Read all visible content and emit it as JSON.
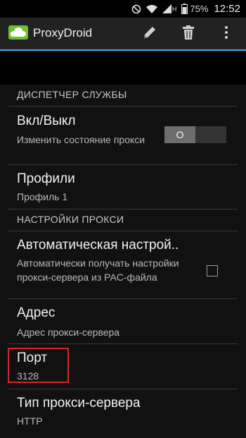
{
  "status_bar": {
    "battery_percent": "75%",
    "time": "12:52",
    "network_letter": "H",
    "icons": [
      "do-not-disturb-icon",
      "wifi-icon",
      "cellular-signal-icon",
      "battery-icon"
    ]
  },
  "action_bar": {
    "title": "ProxyDroid",
    "actions": [
      "edit-icon",
      "delete-icon",
      "overflow-menu-icon"
    ]
  },
  "service_section": {
    "header": "ДИСПЕТЧЕР СЛУЖБЫ",
    "toggle_pref": {
      "title": "Вкл/Выкл",
      "summary": "Изменить состояние прокси",
      "toggle_label": "O"
    },
    "profile_pref": {
      "title": "Профили",
      "summary": "Профиль 1"
    }
  },
  "proxy_section": {
    "header": "НАСТРОЙКИ ПРОКСИ",
    "auto_pref": {
      "title": "Автоматическая настрой..",
      "summary": "Автоматически получать настройки прокси-сервера из PAC-файла",
      "checked": false
    },
    "address_pref": {
      "title": "Адрес",
      "summary": "Адрес прокси-сервера"
    },
    "port_pref": {
      "title": "Порт",
      "summary": "3128"
    },
    "type_pref": {
      "title": "Тип прокси-сервера",
      "summary": "HTTP"
    }
  },
  "colors": {
    "accent": "#33b5e5",
    "highlight": "#d4242a",
    "app_icon": "#6cbf2e"
  }
}
